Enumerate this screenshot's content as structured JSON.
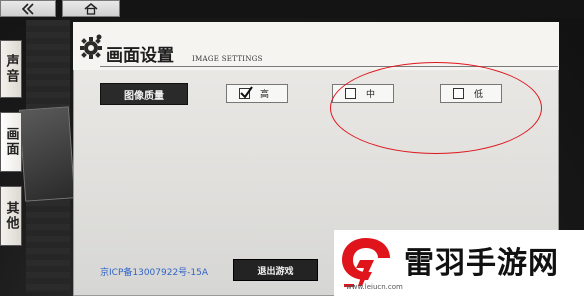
{
  "topbar": {
    "back_icon": "double-chevron-left-icon",
    "home_icon": "home-icon"
  },
  "tabs": [
    {
      "label": "声音",
      "selected": false
    },
    {
      "label": "画面",
      "selected": true
    },
    {
      "label": "其他",
      "selected": false
    }
  ],
  "settings": {
    "title": "画面设置",
    "subtitle": "IMAGE SETTINGS",
    "icon": "gear-icon",
    "quality_label": "图像质量",
    "options": [
      {
        "label": "高",
        "checked": true
      },
      {
        "label": "中",
        "checked": false
      },
      {
        "label": "低",
        "checked": false
      }
    ]
  },
  "footer": {
    "icp": "京ICP备13007922号-15A",
    "exit_label": "退出游戏"
  },
  "watermark": {
    "name": "雷羽手游网",
    "url": "www.leiucn.com"
  },
  "colors": {
    "annotation": "#e0141b",
    "icp_link": "#3264c8",
    "watermark_logo": "#e0141b"
  }
}
